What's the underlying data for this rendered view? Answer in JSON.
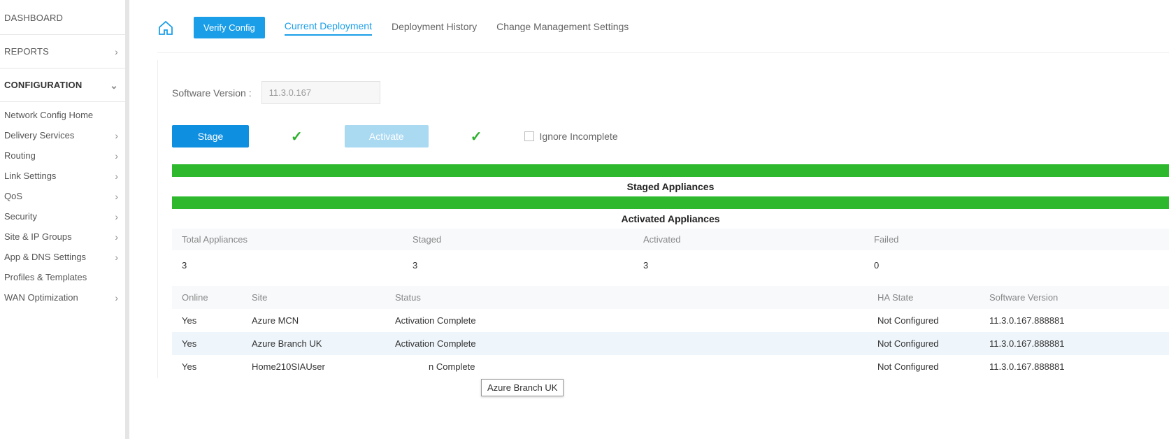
{
  "sidebar": {
    "dashboard": "DASHBOARD",
    "reports": "REPORTS",
    "configuration": "CONFIGURATION",
    "items": [
      "Network Config Home",
      "Delivery Services",
      "Routing",
      "Link Settings",
      "QoS",
      "Security",
      "Site & IP Groups",
      "App & DNS Settings",
      "Profiles & Templates",
      "WAN Optimization"
    ]
  },
  "tabs": {
    "verify": "Verify Config",
    "current": "Current Deployment",
    "history": "Deployment History",
    "cms": "Change Management Settings"
  },
  "software": {
    "label": "Software Version :",
    "value": "11.3.0.167"
  },
  "actions": {
    "stage": "Stage",
    "activate": "Activate",
    "ignore": "Ignore Incomplete"
  },
  "sections": {
    "staged": "Staged Appliances",
    "activated": "Activated Appliances"
  },
  "summary": {
    "headers": [
      "Total Appliances",
      "Staged",
      "Activated",
      "Failed"
    ],
    "values": [
      "3",
      "3",
      "3",
      "0"
    ]
  },
  "table": {
    "headers": [
      "Online",
      "Site",
      "Status",
      "HA State",
      "Software Version"
    ],
    "rows": [
      {
        "online": "Yes",
        "site": "Azure MCN",
        "status": "Activation Complete",
        "ha": "Not Configured",
        "sw": "11.3.0.167.888881"
      },
      {
        "online": "Yes",
        "site": "Azure Branch UK",
        "status": "Activation Complete",
        "ha": "Not Configured",
        "sw": "11.3.0.167.888881"
      },
      {
        "online": "Yes",
        "site": "Home210SIAUser",
        "status": "n Complete",
        "ha": "Not Configured",
        "sw": "11.3.0.167.888881"
      }
    ]
  },
  "tooltip": "Azure Branch UK"
}
